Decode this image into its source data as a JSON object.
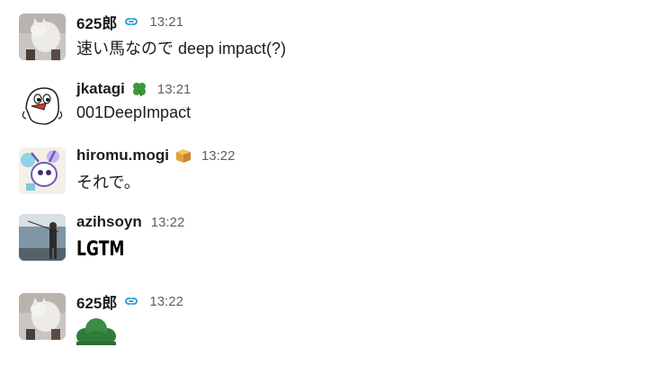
{
  "messages": [
    {
      "sender": "625郎",
      "status_icon": "link-icon",
      "time": "13:21",
      "text": "速い馬なので deep impact(?)",
      "avatar": "cat-avatar"
    },
    {
      "sender": "jkatagi",
      "status_icon": "four-leaf-clover-icon",
      "time": "13:21",
      "text": "001DeepImpact",
      "avatar": "bird-avatar"
    },
    {
      "sender": "hiromu.mogi",
      "status_icon": "box-icon",
      "time": "13:22",
      "text": "それで。",
      "avatar": "character-avatar"
    },
    {
      "sender": "azihsoyn",
      "status_icon": "",
      "time": "13:22",
      "emoji": "LGTM",
      "avatar": "fishing-photo-avatar"
    },
    {
      "sender": "625郎",
      "status_icon": "link-icon",
      "time": "13:22",
      "emoji": "pine-tree-emoji",
      "avatar": "cat-avatar"
    }
  ],
  "colors": {
    "text": "#1d1c1d",
    "timestamp": "#616061",
    "link_icon": "#1d9bd1",
    "clover": "#3a9a3a",
    "pine": "#2f7d3a"
  }
}
